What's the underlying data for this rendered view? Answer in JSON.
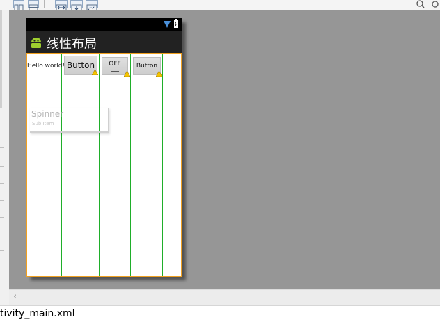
{
  "toolbar": {
    "icons": [
      "layout-horizontal-icon",
      "layout-vertical-icon",
      "fit-width-icon",
      "fit-height-icon",
      "distribute-weights-icon",
      "zoom-icon",
      "refresh-icon"
    ]
  },
  "device": {
    "app_title": "线性布局",
    "widgets": {
      "hello_text": "Hello world!",
      "button1_label": "Button",
      "toggle_label": "OFF",
      "button2_label": "Button",
      "spinner_title": "Spinner",
      "spinner_subtitle": "Sub Item"
    }
  },
  "editor": {
    "tab_label": "tivity_main.xml"
  },
  "colors": {
    "canvas": "#969696",
    "selection_border": "#f0a020",
    "guide_lines": "#1fae2a",
    "action_bar": "#222222",
    "status_bar": "#000000"
  }
}
